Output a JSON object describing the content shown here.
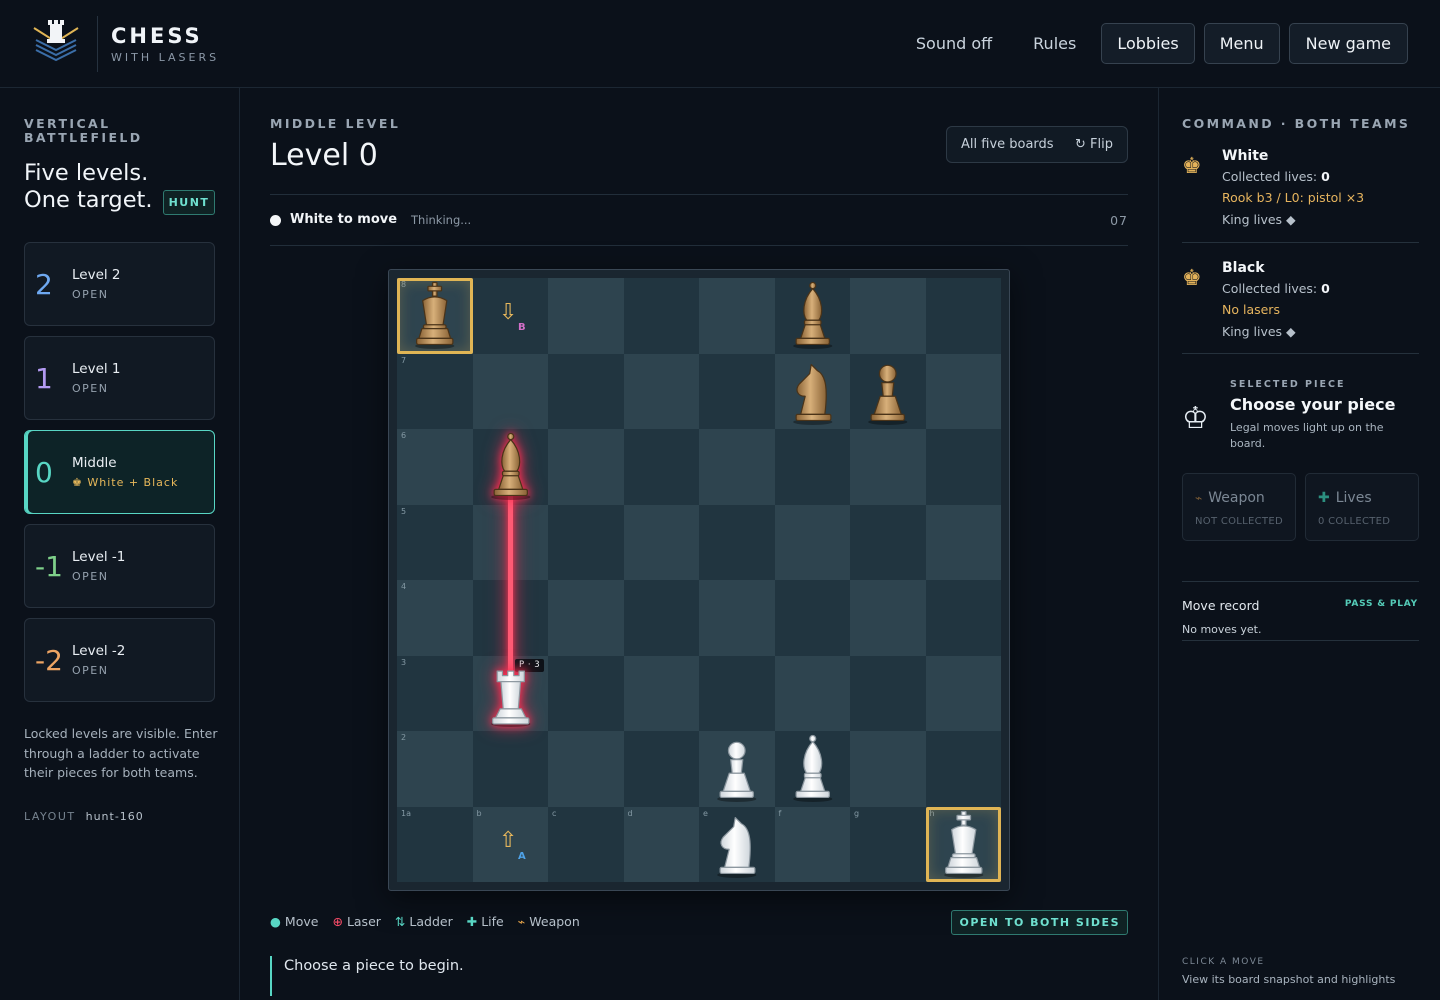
{
  "brand": {
    "title": "CHESS",
    "subtitle": "WITH LASERS"
  },
  "nav": {
    "sound": "Sound off",
    "rules": "Rules",
    "lobbies": "Lobbies",
    "menu": "Menu",
    "new_game": "New game"
  },
  "left": {
    "eyebrow": "VERTICAL BATTLEFIELD",
    "heading_1": "Five levels.",
    "heading_2": "One target.",
    "badge": "HUNT",
    "levels": [
      {
        "num": "2",
        "name": "Level 2",
        "status": "OPEN",
        "color": "#6ea8f0"
      },
      {
        "num": "1",
        "name": "Level 1",
        "status": "OPEN",
        "color": "#b39af2"
      },
      {
        "num": "0",
        "name": "Middle",
        "status": "♚ White + Black",
        "color": "#58d6c4"
      },
      {
        "num": "-1",
        "name": "Level -1",
        "status": "OPEN",
        "color": "#7fd08a"
      },
      {
        "num": "-2",
        "name": "Level -2",
        "status": "OPEN",
        "color": "#eda463"
      }
    ],
    "note": "Locked levels are visible. Enter through a ladder to activate their pieces for both teams.",
    "layout_label": "LAYOUT",
    "layout_value": "hunt-160"
  },
  "center": {
    "eyebrow": "MIDDLE LEVEL",
    "title": "Level 0",
    "boards_button": "All five boards",
    "flip_button": "↻ Flip",
    "turn": "White to move",
    "turn_status": "Thinking...",
    "turn_count": "07",
    "legend": {
      "move": "Move",
      "laser": "Laser",
      "ladder": "Ladder",
      "life": "Life",
      "weapon": "Weapon"
    },
    "open_badge": "OPEN TO BOTH SIDES",
    "hint": "Choose a piece to begin."
  },
  "board": {
    "rank_labels": [
      "8",
      "7",
      "6",
      "5",
      "4",
      "3",
      "2",
      "1"
    ],
    "file_labels": [
      "a",
      "b",
      "c",
      "d",
      "e",
      "f",
      "g",
      "h"
    ],
    "pistol_tag": "P · 3",
    "ladder_top_tag": "B",
    "ladder_bottom_tag": "A",
    "pieces": [
      {
        "square": "a8",
        "type": "king",
        "color": "black"
      },
      {
        "square": "f8",
        "type": "bishop",
        "color": "black"
      },
      {
        "square": "f7",
        "type": "knight",
        "color": "black"
      },
      {
        "square": "g7",
        "type": "pawn",
        "color": "black"
      },
      {
        "square": "b6",
        "type": "bishop",
        "color": "black"
      },
      {
        "square": "b3",
        "type": "rook",
        "color": "white"
      },
      {
        "square": "e2",
        "type": "pawn",
        "color": "white"
      },
      {
        "square": "f2",
        "type": "bishop",
        "color": "white"
      },
      {
        "square": "e1",
        "type": "knight",
        "color": "white"
      },
      {
        "square": "h1",
        "type": "king",
        "color": "white"
      }
    ],
    "highlighted": [
      "a8",
      "h1"
    ],
    "ladders": [
      {
        "square": "b8",
        "direction": "down",
        "tag": "B"
      },
      {
        "square": "b1",
        "direction": "up",
        "tag": "A"
      }
    ],
    "laser": {
      "from": "b3",
      "to": "b6"
    }
  },
  "right": {
    "eyebrow": "COMMAND · BOTH TEAMS",
    "white": {
      "name": "White",
      "lives_label": "Collected lives: ",
      "lives": "0",
      "weapon": "Rook b3 / L0: pistol ×3",
      "king": "King lives ◆"
    },
    "black": {
      "name": "Black",
      "lives_label": "Collected lives: ",
      "lives": "0",
      "weapon": "No lasers",
      "king": "King lives ◆"
    },
    "selected": {
      "eyebrow": "SELECTED PIECE",
      "title": "Choose your piece",
      "desc": "Legal moves light up on the board."
    },
    "weapon_stat": {
      "title": "Weapon",
      "sub": "NOT COLLECTED"
    },
    "lives_stat": {
      "title": "Lives",
      "sub": "0 COLLECTED"
    },
    "move_record": "Move record",
    "move_tag": "PASS & PLAY",
    "no_moves": "No moves yet.",
    "click_eyebrow": "CLICK A MOVE",
    "click_desc": "View its board snapshot and highlights"
  },
  "colors": {
    "accent": "#58d6c4",
    "gold": "#e0b555",
    "laser": "#ff5a74",
    "light_square": "#2e444f",
    "dark_square": "#213540"
  }
}
